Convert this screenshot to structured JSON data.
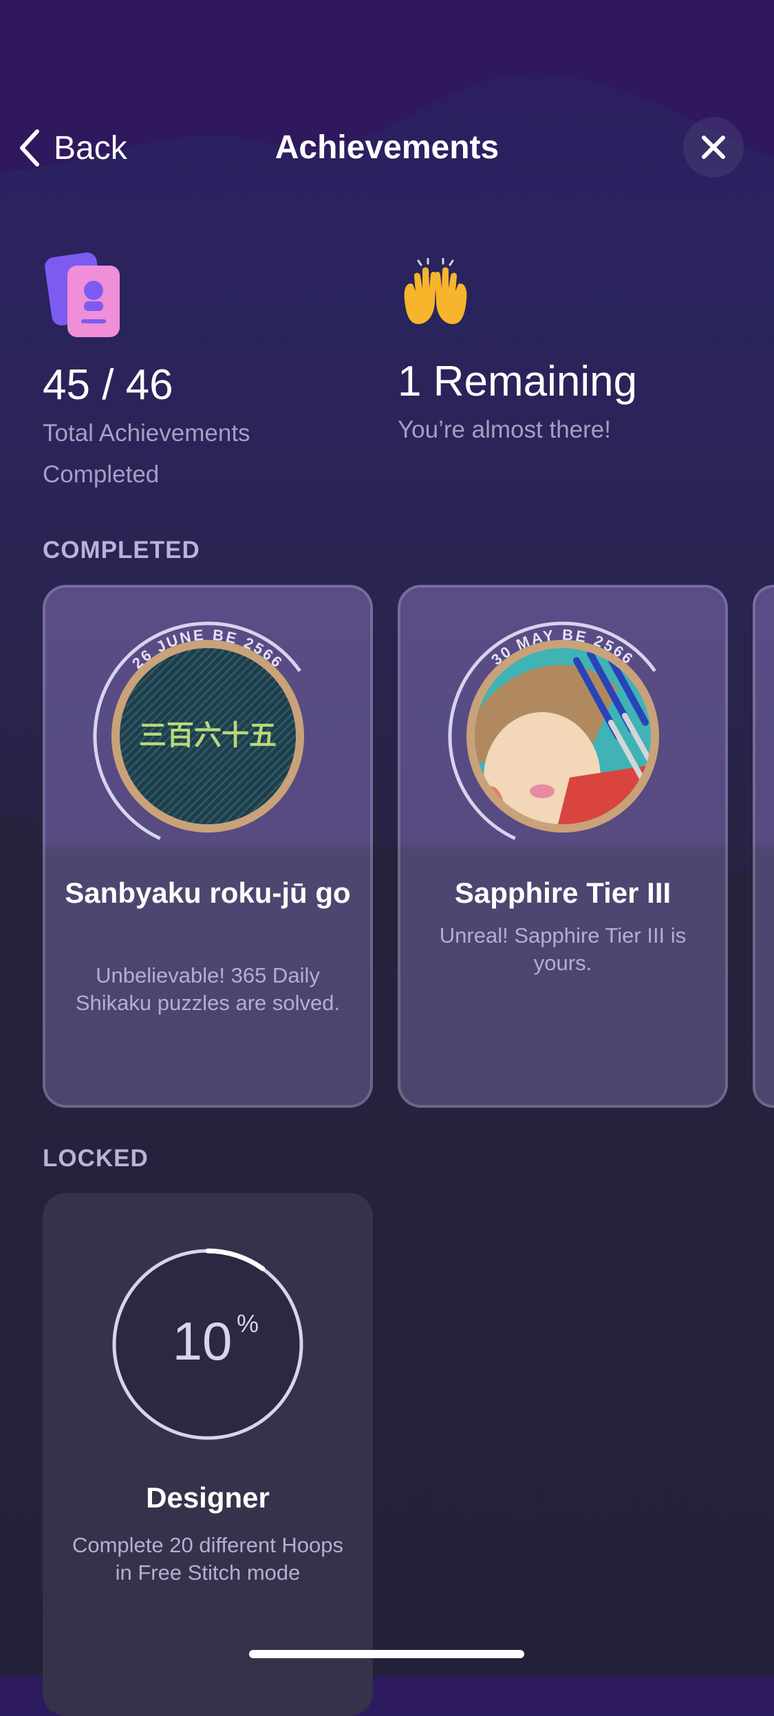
{
  "nav": {
    "back_label": "Back",
    "title": "Achievements"
  },
  "stats": {
    "completed_count": "45 / 46",
    "completed_caption_1": "Total Achievements",
    "completed_caption_2": "Completed",
    "remaining_count": "1 Remaining",
    "remaining_caption": "You’re almost there!"
  },
  "sections": {
    "completed_label": "COMPLETED",
    "locked_label": "LOCKED"
  },
  "completed_cards": [
    {
      "date": "26 JUNE BE 2566",
      "badge_text": "三百六十五",
      "title": "Sanbyaku roku-jū go",
      "description": "Unbelievable! 365 Daily Shikaku puzzles are solved."
    },
    {
      "date": "30 MAY BE 2566",
      "title": "Sapphire Tier III",
      "description": "Unreal! Sapphire Tier III is yours."
    }
  ],
  "locked_cards": [
    {
      "progress_number": "10",
      "progress_unit": "%",
      "progress_fraction": 0.1,
      "title": "Designer",
      "description": "Complete 20 different Hoops in Free Stitch mode"
    }
  ],
  "colors": {
    "accent_purple": "#7c5cf0",
    "accent_pink": "#f08ed8",
    "text_muted": "#a49fc4"
  },
  "icons": {
    "back": "chevron-left-icon",
    "close": "close-icon",
    "achievements": "cards-icon",
    "remaining": "raised-hands-icon"
  }
}
